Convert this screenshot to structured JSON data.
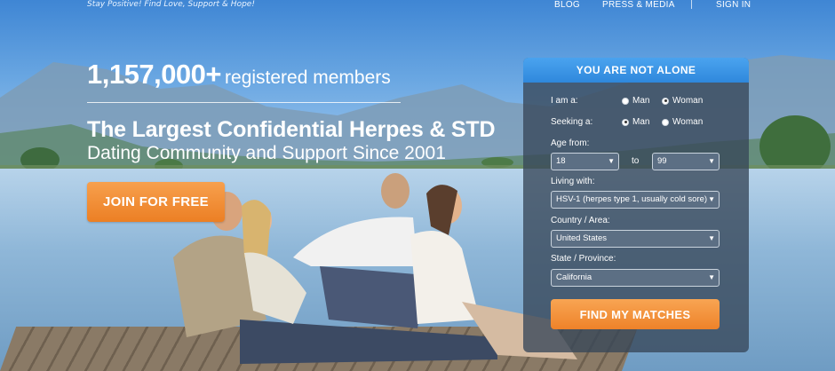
{
  "header": {
    "tagline": "Stay Positive! Find Love, Support & Hope!",
    "nav": [
      "BLOG",
      "PRESS & MEDIA",
      "SIGN IN"
    ]
  },
  "hero": {
    "member_count": "1,157,000+",
    "member_suffix": "registered members",
    "headline": "The Largest Confidential Herpes & STD",
    "subheadline": "Dating Community and Support Since 2001",
    "join_label": "JOIN FOR FREE"
  },
  "search_panel": {
    "title": "YOU ARE NOT ALONE",
    "i_am_label": "I am a:",
    "i_am_options": [
      "Man",
      "Woman"
    ],
    "i_am_selected": "Woman",
    "seeking_label": "Seeking a:",
    "seeking_options": [
      "Man",
      "Woman"
    ],
    "seeking_selected": "Man",
    "age_from_label": "Age from:",
    "age_from": "18",
    "age_to_label": "to",
    "age_to": "99",
    "living_with_label": "Living with:",
    "living_with": "HSV-1 (herpes type 1, usually cold sore)",
    "country_label": "Country / Area:",
    "country": "United States",
    "state_label": "State / Province:",
    "state": "California",
    "submit_label": "FIND MY MATCHES"
  },
  "colors": {
    "accent_orange": "#ee8229",
    "header_blue": "#2f88dc",
    "panel_bg": "#374658"
  }
}
